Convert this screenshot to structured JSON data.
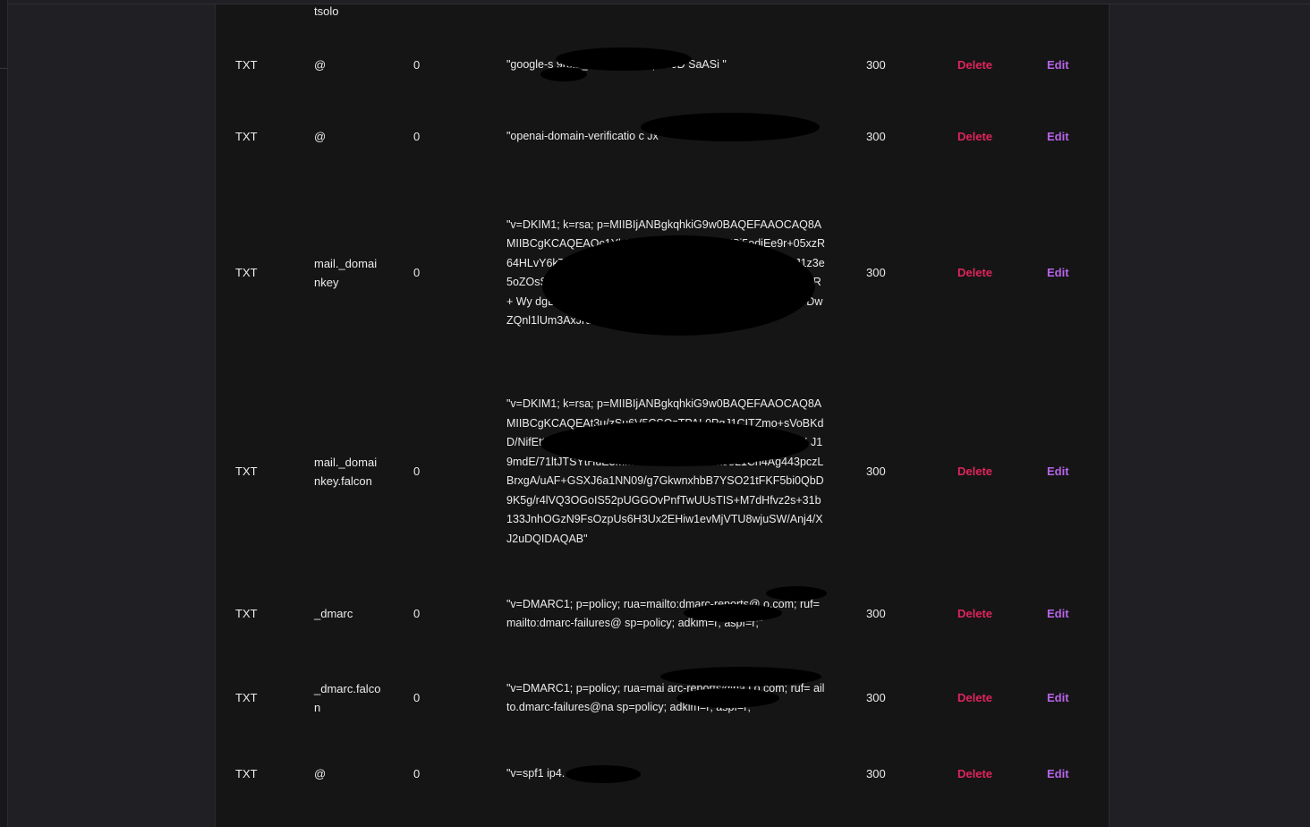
{
  "theme": {
    "background": "#202024",
    "panel": "#151515",
    "text": "#ececec",
    "delete_color": "#e0245e",
    "edit_color": "#b664e8"
  },
  "partial_row": {
    "name": "tsolo"
  },
  "records": [
    {
      "type": "TXT",
      "name": "@",
      "priority": "0",
      "content": "\"google-s                              9r5jb_KDuhMICLaqHGJD SaASi            \"",
      "ttl": "300",
      "delete_label": "Delete",
      "edit_label": "Edit"
    },
    {
      "type": "TXT",
      "name": "@",
      "priority": "0",
      "content": "\"openai-domain-verificatio                                         c Jx\"",
      "ttl": "300",
      "delete_label": "Delete",
      "edit_label": "Edit"
    },
    {
      "type": "TXT",
      "name": "mail._domainkey",
      "priority": "0",
      "content": "\"v=DKIM1; k=rsa; p=MIIBIjANBgkqhkiG9w0BAQEFAAOCAQ8AMIIBCgKCAQEAOc1Yh27OpakJliBgnB8ODVSj5odjEe9r+05xzR64HLvY6kTmJXUESHR4RZTmWg0037bAS4i5uTZDGMPJ1z3e5oZOsS43Ey91u7hFYe6y9Pom                           Clg2E7ytd                                DE  nT0A1wYITUvR+   Wy                                   dgBRBiHOohpt                                          XCXDVIUmhoUWz5Jbl6wlxdmWYosGDwZQnl1lUm3AxJruvmrqHwzOBQIDAQAB\"",
      "ttl": "300",
      "delete_label": "Delete",
      "edit_label": "Edit"
    },
    {
      "type": "TXT",
      "name": "mail._domainkey.falcon",
      "priority": "0",
      "content": "\"v=DKIM1; k=rsa; p=MIIBIjANBgkqhkiG9w0BAQEFAAOCAQ8AMIIBCgKCAQEAt3u/zSu6V5CSOzTPAL0PgJ1CITZmo+sVoBKdD/NifEttmljKh            G1E1q49c4AxpCzFVPaJk/g88+He4KfBWyfFX                                                  J19mdE/71ltJTSYtHuE3mMn2dzfRaDwlGaYk98L1Cn4Ag443pczLBrxgA/uAF+GSXJ6a1NN09/g7GkwnxhbB7YSO21tFKF5bi0QbD9K5g/r4lVQ3OGoIS52pUGGOvPnfTwUUsTIS+M7dHfvz2s+31b133JnhOGzN9FsOzpUs6H3Ux2EHiw1evMjVTU8wjuSW/Anj4/XJ2uDQIDAQAB\"",
      "ttl": "300",
      "delete_label": "Delete",
      "edit_label": "Edit"
    },
    {
      "type": "TXT",
      "name": "_dmarc",
      "priority": "0",
      "content": "\"v=DMARC1; p=policy; rua=mailto:dmarc-reports@               o.com; ruf=mailto:dmarc-failures@                    sp=policy; adkim=r; aspf=r;\"",
      "ttl": "300",
      "delete_label": "Delete",
      "edit_label": "Edit"
    },
    {
      "type": "TXT",
      "name": "_dmarc.falcon",
      "priority": "0",
      "content": "\"v=DMARC1; p=policy; rua=mai               arc-reports@na             l o.com; ruf=    ailto.dmarc-failures@na                sp=policy; adkim=r; aspf=r;\"",
      "ttl": "300",
      "delete_label": "Delete",
      "edit_label": "Edit"
    },
    {
      "type": "TXT",
      "name": "@",
      "priority": "0",
      "content": "\"v=spf1 ip4.                ~all\"",
      "ttl": "300",
      "delete_label": "Delete",
      "edit_label": "Edit"
    }
  ]
}
